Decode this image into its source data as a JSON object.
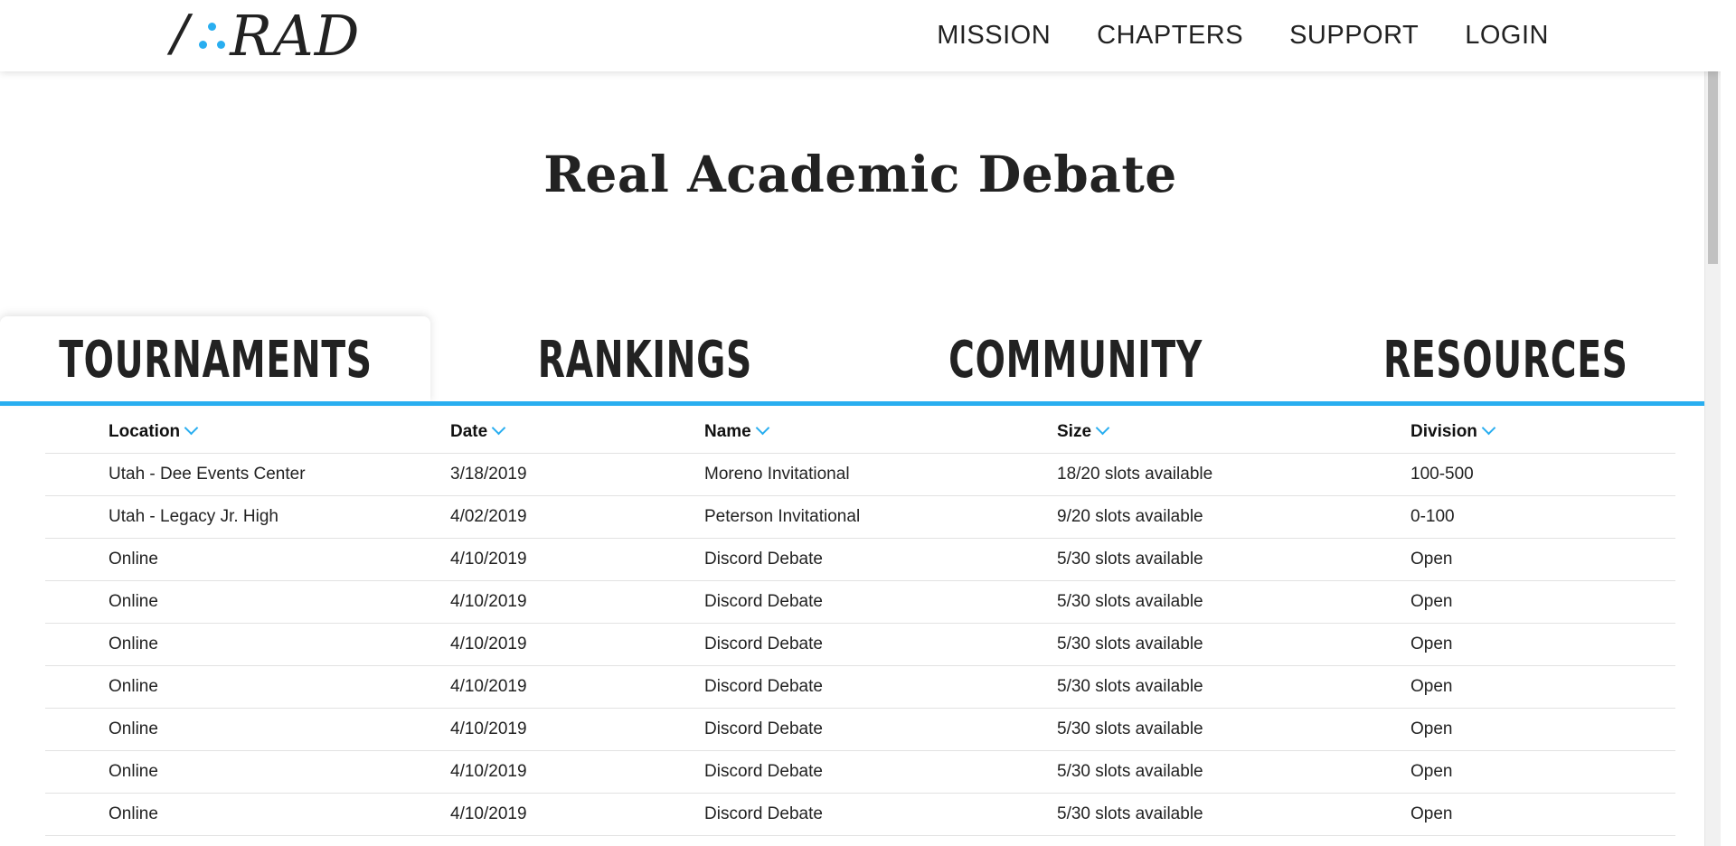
{
  "header": {
    "logo_text": "RAD",
    "nav": [
      "MISSION",
      "CHAPTERS",
      "SUPPORT",
      "LOGIN"
    ]
  },
  "page_title": "Real Academic Debate",
  "tabs": [
    "TOURNAMENTS",
    "RANKINGS",
    "COMMUNITY",
    "RESOURCES"
  ],
  "active_tab": "TOURNAMENTS",
  "table": {
    "columns": [
      "Location",
      "Date",
      "Name",
      "Size",
      "Division"
    ],
    "rows": [
      [
        "Utah - Dee Events Center",
        "3/18/2019",
        "Moreno Invitational",
        "18/20 slots available",
        "100-500"
      ],
      [
        "Utah - Legacy Jr. High",
        "4/02/2019",
        "Peterson Invitational",
        "9/20 slots available",
        "0-100"
      ],
      [
        "Online",
        "4/10/2019",
        "Discord Debate",
        "5/30 slots available",
        "Open"
      ],
      [
        "Online",
        "4/10/2019",
        "Discord Debate",
        "5/30 slots available",
        "Open"
      ],
      [
        "Online",
        "4/10/2019",
        "Discord Debate",
        "5/30 slots available",
        "Open"
      ],
      [
        "Online",
        "4/10/2019",
        "Discord Debate",
        "5/30 slots available",
        "Open"
      ],
      [
        "Online",
        "4/10/2019",
        "Discord Debate",
        "5/30 slots available",
        "Open"
      ],
      [
        "Online",
        "4/10/2019",
        "Discord Debate",
        "5/30 slots available",
        "Open"
      ],
      [
        "Online",
        "4/10/2019",
        "Discord Debate",
        "5/30 slots available",
        "Open"
      ]
    ]
  },
  "colors": {
    "accent": "#29aef0",
    "text": "#222222"
  }
}
